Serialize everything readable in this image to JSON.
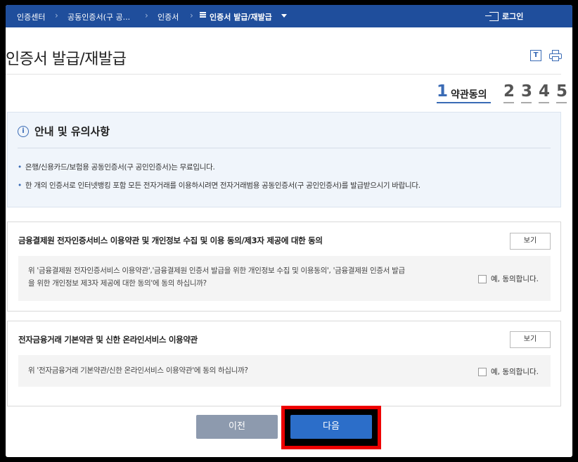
{
  "topbar": {
    "crumbs": [
      "인증센터",
      "공동인증서(구 공...",
      "인증서"
    ],
    "current": "인증서 발급/재발급",
    "login": "로그인"
  },
  "page": {
    "title": "인증서 발급/재발급",
    "font_icon": "T"
  },
  "steps": {
    "active_number": "1",
    "active_label": "약관동의",
    "others": [
      "2",
      "3",
      "4",
      "5"
    ]
  },
  "notice": {
    "title": "안내 및 유의사항",
    "info_icon": "i",
    "items": [
      "은행/신용카드/보험용 공동인증서(구 공인인증서)는 무료입니다.",
      "한 개의 인증서로 인터넷뱅킹 포함 모든 전자거래를 이용하시려면 전자거래범용 공동인증서(구 공인인증서)를 발급받으시기 바랍니다."
    ]
  },
  "sections": [
    {
      "title": "금융결제원 전자인증서비스 이용약관 및 개인정보 수집 및 이용 동의/제3자 제공에 대한 동의",
      "view_label": "보기",
      "question_line1": "위 '금융결제원 전자인증서비스 이용약관','금융결제원 인증서 발급을 위한 개인정보 수집 및 이용동의', '금융결제원 인증서 발급",
      "question_line2": "을 위한 개인정보 제3자 제공에 대한 동의'에 동의 하십니까?",
      "agree_label": "예, 동의합니다."
    },
    {
      "title": "전자금융거래 기본약관 및 신한 온라인서비스 이용약관",
      "view_label": "보기",
      "question_line1": "위 '전자금융거래 기본약관/신한 온라인서비스 이용약관'에 동의 하십니까?",
      "agree_label": "예, 동의합니다."
    }
  ],
  "buttons": {
    "prev": "이전",
    "next": "다음"
  },
  "colors": {
    "nav_bg": "#1f4e9c",
    "accent": "#3a6bb5",
    "next_btn": "#2c6ec9",
    "prev_btn": "#8d9aae",
    "highlight": "#e00000"
  }
}
